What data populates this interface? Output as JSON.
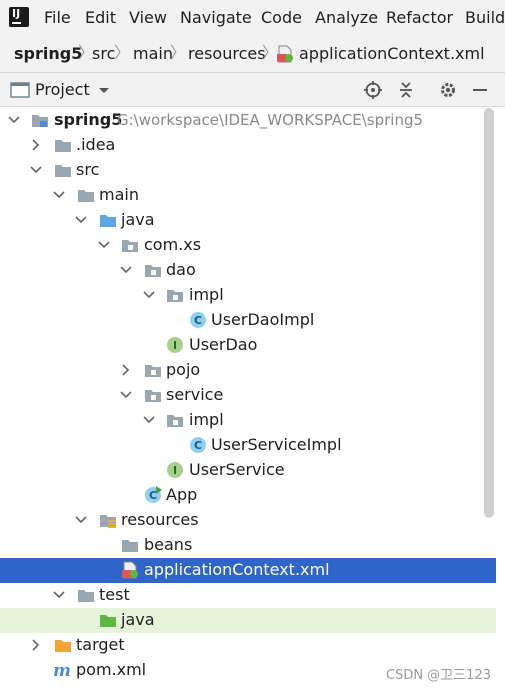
{
  "menu": [
    "File",
    "Edit",
    "View",
    "Navigate",
    "Code",
    "Analyze",
    "Refactor",
    "Build"
  ],
  "breadcrumb": [
    "spring5",
    "src",
    "main",
    "resources",
    "applicationContext.xml"
  ],
  "panel": {
    "title": "Project"
  },
  "tree": {
    "root_label": "spring5",
    "root_path": "G:\\workspace\\IDEA_WORKSPACE\\spring5",
    "idea": ".idea",
    "src": "src",
    "main": "main",
    "java": "java",
    "comxs": "com.xs",
    "dao": "dao",
    "dao_impl": "impl",
    "userdaoimpl": "UserDaoImpl",
    "userdao": "UserDao",
    "pojo": "pojo",
    "service": "service",
    "service_impl": "impl",
    "userserviceimpl": "UserServiceImpl",
    "userservice": "UserService",
    "app": "App",
    "resources": "resources",
    "beans": "beans",
    "appctx": "applicationContext.xml",
    "test": "test",
    "test_java": "java",
    "target": "target",
    "pom": "pom.xml"
  },
  "watermark": "CSDN @卫三123",
  "colors": {
    "selection": "#2f65ca",
    "folder": "#9aa7b0",
    "source_root": "#5ea7e3",
    "test_root": "#62b543",
    "excluded": "#f0a732"
  }
}
